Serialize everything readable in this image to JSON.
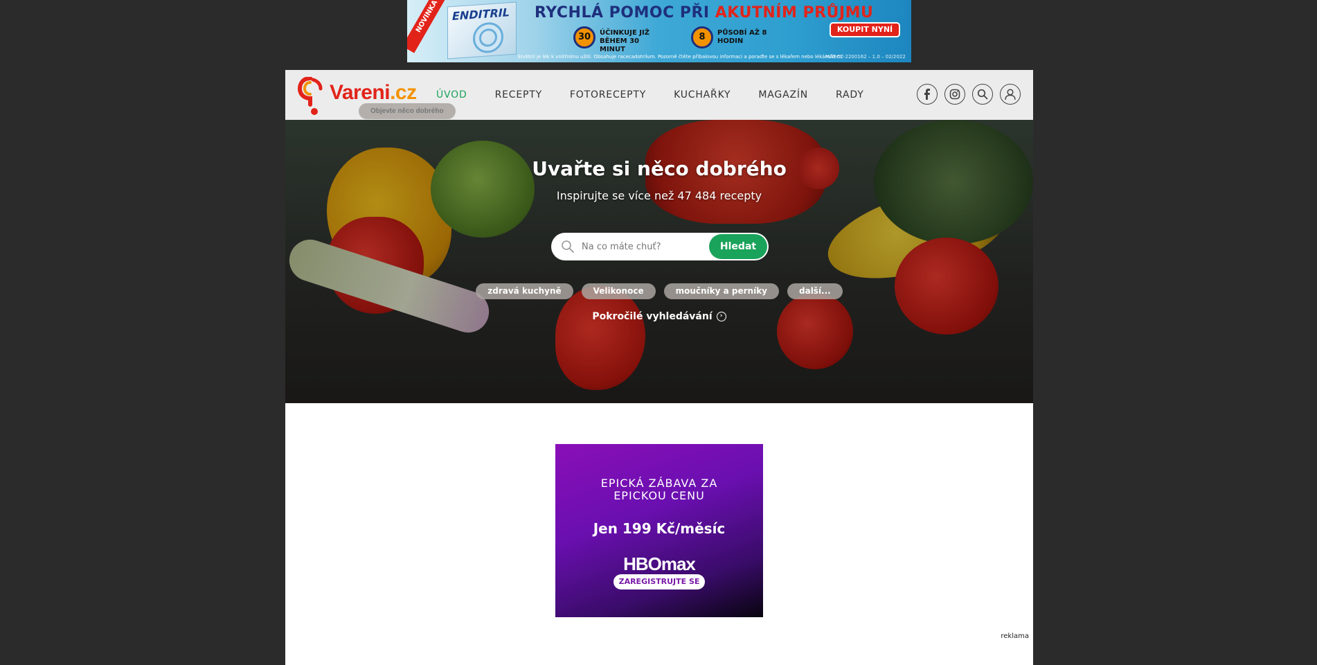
{
  "top_ad": {
    "ribbon": "NOVINKA",
    "brand": "ENDITRIL",
    "headline_a": "RYCHLÁ POMOC PŘI ",
    "headline_b": "AKUTNÍM PRŮJMU",
    "badge1": "30",
    "badge1_text": "ÚČINKUJE JIŽ BĚHEM 30 MINUT",
    "badge2": "8",
    "badge2_text": "PŮSOBÍ AŽ 8 HODIN",
    "cta": "KOUPIT NYNÍ",
    "disclaimer": "Enditril je lék k vnitřnímu užití. Obsahuje racecadotrilum. Pozorně čtěte příbalovou informaci a poraďte se s lékařem nebo lékárníkem.",
    "code": "MAT-CZ-2200162 – 1.0 – 02/2022"
  },
  "header": {
    "logo_word": "Vareni",
    "logo_tld": ".cz",
    "logo_tagline": "Objevte něco dobrého",
    "nav": [
      "ÚVOD",
      "RECEPTY",
      "FOTORECEPTY",
      "KUCHAŘKY",
      "MAGAZÍN",
      "RADY"
    ],
    "icons": [
      "facebook-icon",
      "instagram-icon",
      "search-icon",
      "user-icon"
    ]
  },
  "hero": {
    "title": "Uvařte si něco dobrého",
    "subtitle": "Inspirujte se více než 47 484 recepty",
    "search_placeholder": "Na co máte chuť?",
    "search_button": "Hledat",
    "tags": [
      "zdravá kuchyně",
      "Velikonoce",
      "moučníky a perníky",
      "další..."
    ],
    "advanced_search": "Pokročilé vyhledávání"
  },
  "hbo_ad": {
    "line1": "EPICKÁ ZÁBAVA ZA",
    "line2": "EPICKOU CENU",
    "price": "Jen 199 Kč/měsíc",
    "logo": "HBOmax",
    "cta": "ZAREGISTRUJTE SE"
  },
  "ad_label": "reklama",
  "colors": {
    "accent_green": "#1aa35a",
    "brand_red": "#e2231a",
    "brand_orange": "#f39200",
    "page_background": "#2b2b2b"
  }
}
